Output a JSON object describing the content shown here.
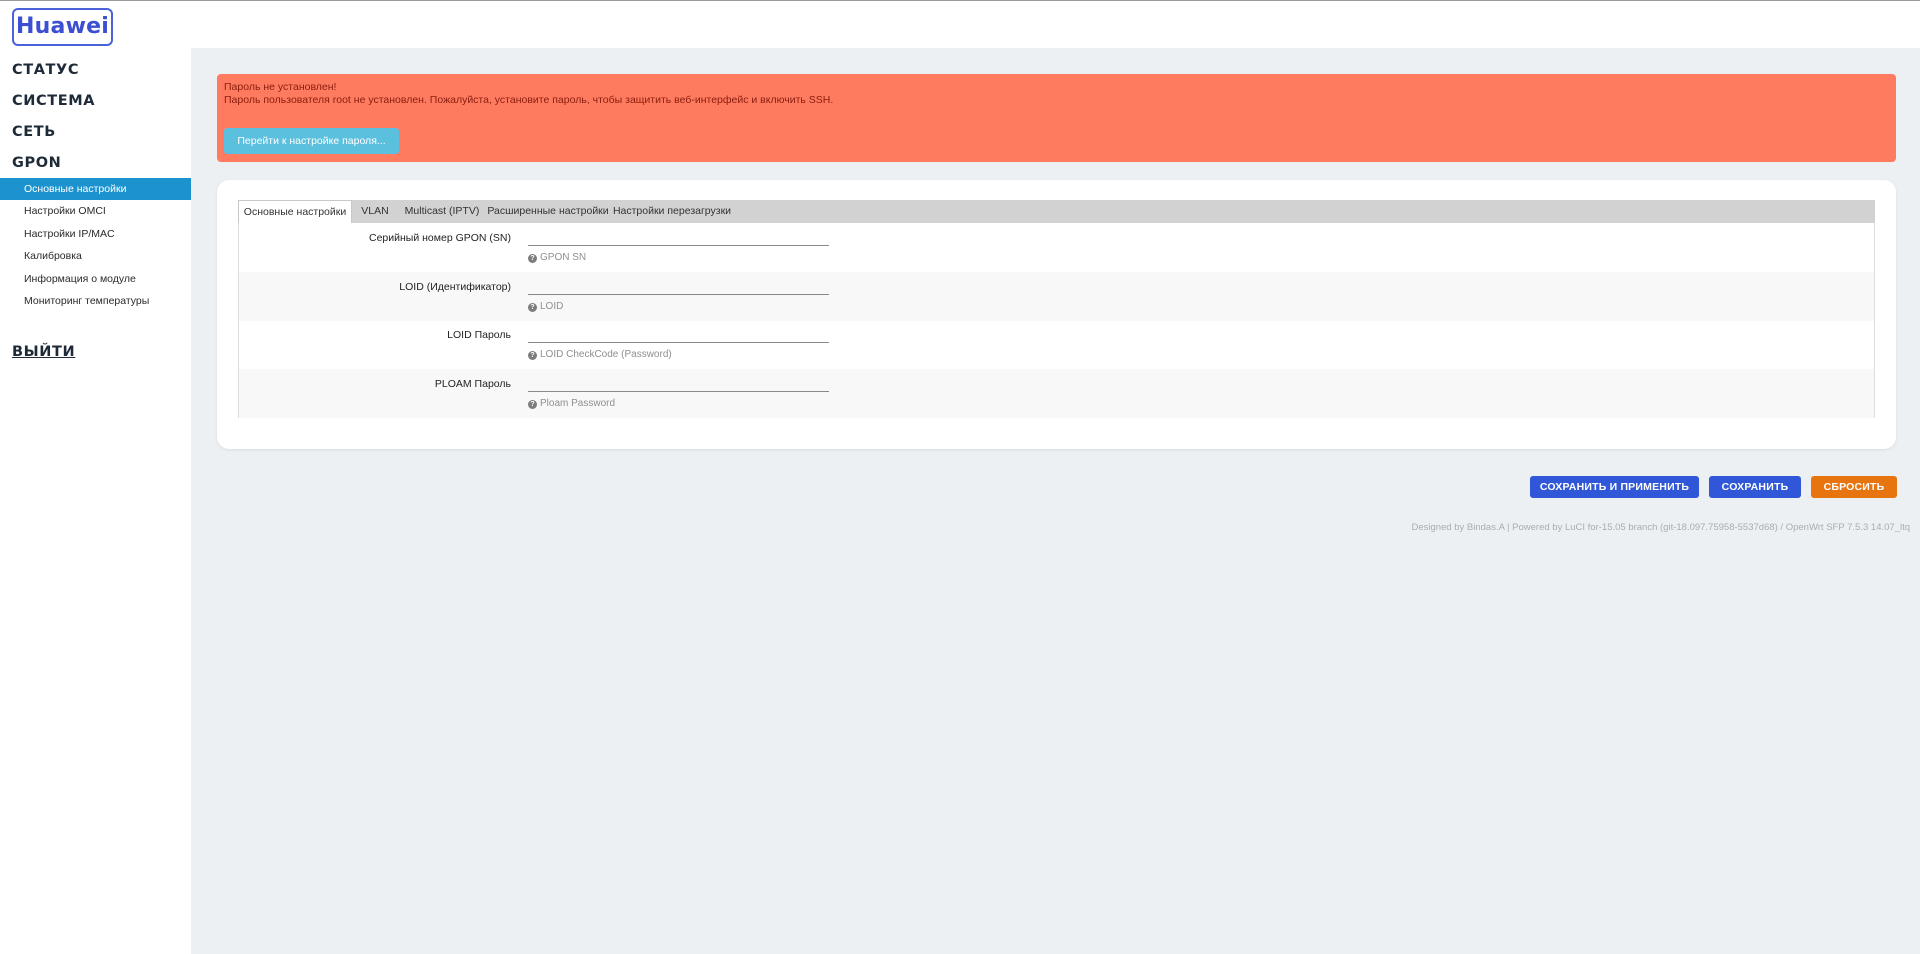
{
  "header": {
    "logo_text": "Huawei"
  },
  "sidebar": {
    "groups": [
      {
        "label": "СТАТУС"
      },
      {
        "label": "СИСТЕМА"
      },
      {
        "label": "СЕТЬ"
      },
      {
        "label": "GPON"
      }
    ],
    "items": [
      {
        "label": "Основные настройки",
        "active": true
      },
      {
        "label": "Настройки OMCI",
        "active": false
      },
      {
        "label": "Настройки IP/MAC",
        "active": false
      },
      {
        "label": "Калибровка",
        "active": false
      },
      {
        "label": "Информация о модуле",
        "active": false
      },
      {
        "label": "Мониторинг температуры",
        "active": false
      }
    ],
    "logout_label": "ВЫЙТИ"
  },
  "alert": {
    "title": "Пароль не установлен!",
    "message": "Пароль пользователя root не установлен. Пожалуйста, установите пароль, чтобы защитить веб-интерфейс и включить SSH.",
    "button_label": "Перейти к настройке пароля...",
    "color": "#ff7b60"
  },
  "tabs": [
    {
      "label": "Основные настройки",
      "active": true
    },
    {
      "label": "VLAN",
      "active": false
    },
    {
      "label": "Multicast (IPTV)",
      "active": false
    },
    {
      "label": "Расширенные настройки",
      "active": false
    },
    {
      "label": "Настройки перезагрузки",
      "active": false
    }
  ],
  "form": {
    "fields": [
      {
        "label": "Серийный номер GPON (SN)",
        "value": "",
        "hint": "GPON SN"
      },
      {
        "label": "LOID (Идентификатор)",
        "value": "",
        "hint": "LOID"
      },
      {
        "label": "LOID Пароль",
        "value": "",
        "hint": "LOID CheckCode (Password)"
      },
      {
        "label": "PLOAM Пароль",
        "value": "",
        "hint": "Ploam Password"
      }
    ],
    "hint_icon": "question-circle-icon"
  },
  "actions": {
    "save_apply_label": "СОХРАНИТЬ И ПРИМЕНИТЬ",
    "save_label": "СОХРАНИТЬ",
    "reset_label": "СБРОСИТЬ"
  },
  "footer": {
    "text": "Designed by Bindas.A | Powered by LuCI for-15.05 branch (git-18.097.75958-5537d68) / OpenWrt SFP 7.5.3 14.07_ltq"
  },
  "colors": {
    "accent": "#1c93cf",
    "brand": "#3b4fd0",
    "button_blue": "#3057d8",
    "button_orange": "#e8740f"
  }
}
